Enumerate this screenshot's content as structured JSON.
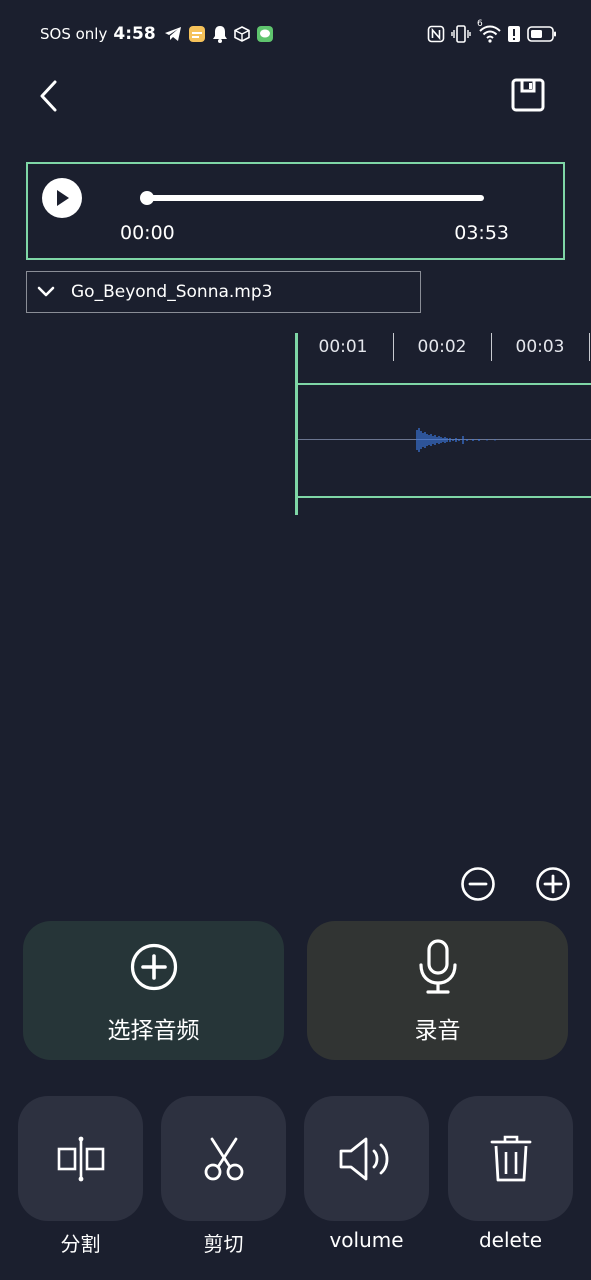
{
  "status_bar": {
    "carrier": "SOS only",
    "time": "4:58",
    "signal_label": "6",
    "left_icons": [
      "telegram-icon",
      "notes-app-icon",
      "bell-icon",
      "cube-icon",
      "chat-app-icon"
    ],
    "right_icons": [
      "nfc-icon",
      "vibrate-icon",
      "wifi-icon",
      "alert-icon",
      "battery-icon"
    ]
  },
  "top_bar": {
    "back_icon": "chevron-left-icon",
    "save_icon": "save-icon"
  },
  "player": {
    "current_time": "00:00",
    "total_time": "03:53",
    "progress": 0.0
  },
  "file": {
    "name": "Go_Beyond_Sonna.mp3"
  },
  "timeline": {
    "labels": [
      "00:01",
      "00:02",
      "00:03"
    ]
  },
  "zoom": {
    "out_icon": "zoom-out-icon",
    "in_icon": "zoom-in-icon"
  },
  "actions": {
    "select_audio": "选择音频",
    "record": "录音"
  },
  "tools": {
    "split": "分割",
    "cut": "剪切",
    "volume": "volume",
    "delete": "delete"
  },
  "colors": {
    "background": "#1b1f2e",
    "accent_green": "#7fd6a6",
    "waveform": "#3b78e0",
    "select_button": "#263538",
    "record_button": "#313433",
    "tool_button": "#2d3140"
  }
}
